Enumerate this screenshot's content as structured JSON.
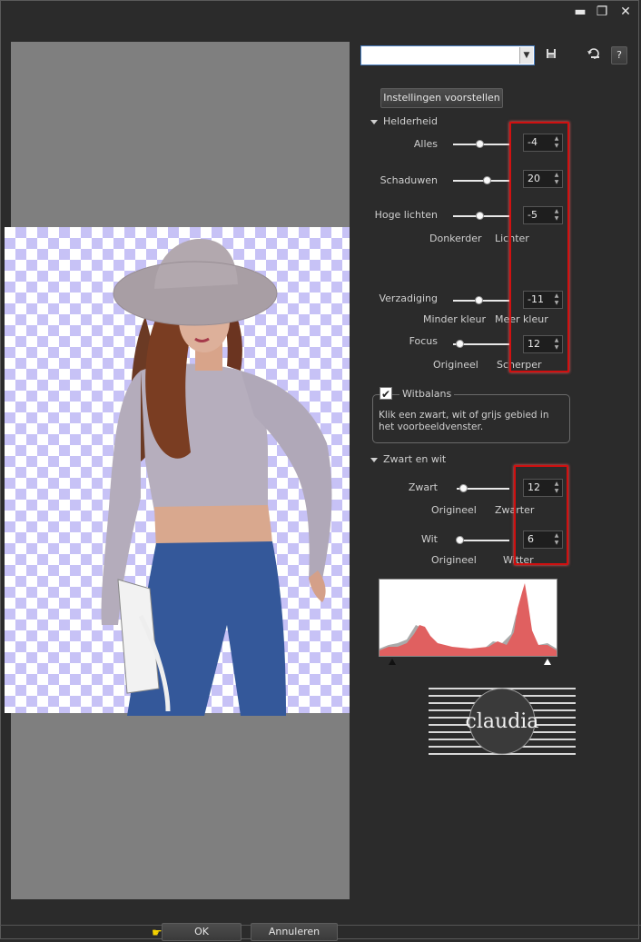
{
  "window": {
    "controls": {
      "minimize_icon": "minimize-icon",
      "restore_icon": "restore-icon",
      "close_icon": "close-icon"
    }
  },
  "toolbar": {
    "preset_value": "",
    "save_icon": "save-icon",
    "reset_icon": "reset-icon",
    "help_label": "?"
  },
  "suggest_button": "Instellingen voorstellen",
  "brightness": {
    "title": "Helderheid",
    "all_label": "Alles",
    "all_value": "-4",
    "all_level": 0.47,
    "shadows_label": "Schaduwen",
    "shadows_value": "20",
    "shadows_level": 0.6,
    "highlights_label": "Hoge lichten",
    "highlights_value": "-5",
    "highlights_level": 0.47,
    "darker_label": "Donkerder",
    "lighter_label": "Lichter",
    "saturation_label": "Verzadiging",
    "saturation_value": "-11",
    "saturation_level": 0.45,
    "less_color_label": "Minder kleur",
    "more_color_label": "Meer kleur",
    "focus_label": "Focus",
    "focus_value": "12",
    "focus_level": 0.12,
    "original_label": "Origineel",
    "sharper_label": "Scherper"
  },
  "white_balance": {
    "title": "Witbalans",
    "checked": true,
    "description": "Klik een zwart, wit of grijs gebied in het voorbeeldvenster."
  },
  "black_white": {
    "title": "Zwart en wit",
    "black_label": "Zwart",
    "black_value": "12",
    "black_level": 0.12,
    "original_label": "Origineel",
    "blacker_label": "Zwarter",
    "white_label": "Wit",
    "white_value": "6",
    "white_level": 0.06,
    "original_label2": "Origineel",
    "whiter_label": "Witter"
  },
  "logo": {
    "text": "claudia"
  },
  "footer": {
    "ok_label": "OK",
    "cancel_label": "Annuleren",
    "pointer_icon": "hand-pointer-icon"
  },
  "colors": {
    "highlight_red": "#d01010",
    "histogram_red": "#e06060",
    "checker": "#c7c2f6"
  }
}
